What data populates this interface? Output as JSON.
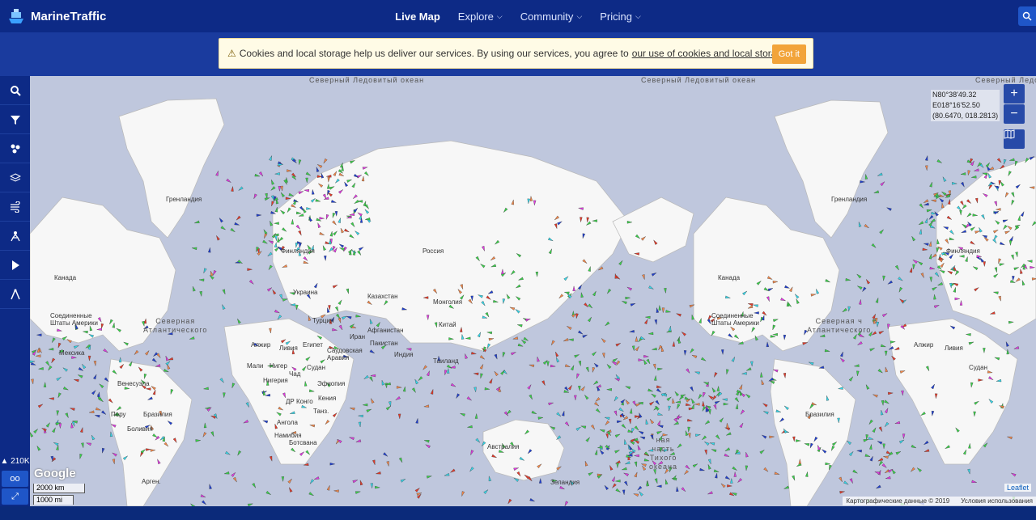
{
  "header": {
    "logo": "MarineTraffic",
    "nav": [
      {
        "label": "Live Map",
        "active": true,
        "dropdown": false
      },
      {
        "label": "Explore",
        "active": false,
        "dropdown": true
      },
      {
        "label": "Community",
        "active": false,
        "dropdown": true
      },
      {
        "label": "Pricing",
        "active": false,
        "dropdown": true
      }
    ]
  },
  "cookie_banner": {
    "text": "Cookies and local storage help us deliver our services. By using our services, you agree to",
    "link": "our use of cookies and local storage",
    "button": "Got it"
  },
  "sidebar": {
    "tools": [
      "search-icon",
      "filter-icon",
      "density-icon",
      "layers-icon",
      "weather-icon",
      "route-icon",
      "play-icon",
      "measure-icon"
    ],
    "vessel_count": "210K",
    "bottom_buttons": [
      "oo",
      "fullscreen"
    ]
  },
  "map": {
    "coords": [
      "N80°38'49.32",
      "E018°16'52.50",
      "(80.6470, 018.2813)"
    ],
    "zoom_in": "+",
    "zoom_out": "−",
    "google": "Google",
    "scale_km": "2000 km",
    "scale_mi": "1000 mi",
    "attribution": "Картографические данные © 2019",
    "terms": "Условия использования",
    "leaflet": "Leaflet",
    "labels": {
      "arctic1": "Северный\nЛедовитый\nокеан",
      "arctic2": "Северный\nЛедовитый\nокеан",
      "arctic3": "Северный\nЛедовитый",
      "greenland1": "Гренландия",
      "greenland2": "Гренландия",
      "canada1": "Канада",
      "canada2": "Канада",
      "usa1": "Соединенные\nШтаты Америки",
      "usa2": "Соединенные\nШтаты Америки",
      "atlantic1": "Северная\nАтлантического",
      "atlantic2": "Северная ч\nАтлантического",
      "russia": "Россия",
      "finland1": "Финляндия",
      "finland2": "Финляндия",
      "ukraine": "Украина",
      "kazakhstan": "Казахстан",
      "mongolia": "Монголия",
      "china": "Китай",
      "iran": "Иран",
      "afghanistan": "Афганистан",
      "pakistan": "Пакистан",
      "india": "Индия",
      "thailand": "Таиланд",
      "algeria1": "Алжир",
      "algeria2": "Алжир",
      "libya1": "Ливия",
      "libya2": "Ливия",
      "egypt": "Египет",
      "sudan1": "Судан",
      "sudan2": "Судан",
      "mali1": "Мали",
      "niger": "Нигер",
      "chad": "Чад",
      "nigeria": "Нигерия",
      "ethiopia": "Эфиопия",
      "drc": "ДР Конго",
      "kenya": "Кения",
      "tanzania": "Танз.",
      "angola": "Ангола",
      "namibia": "Намибия",
      "botswana": "Ботсвана",
      "brazil1": "Бразилия",
      "brazil2": "Бразилия",
      "bolivia": "Боливия",
      "peru": "Перу",
      "venezuela": "Венесуэла",
      "mexico": "Мексика",
      "turkey": "Турция",
      "saudi": "Саудовская\nАравия",
      "australia": "Австралия",
      "pacific": "ная\nчасть\nТихого\nокеана",
      "argentina": "Арген.",
      "zealand": "Зеландия"
    }
  }
}
